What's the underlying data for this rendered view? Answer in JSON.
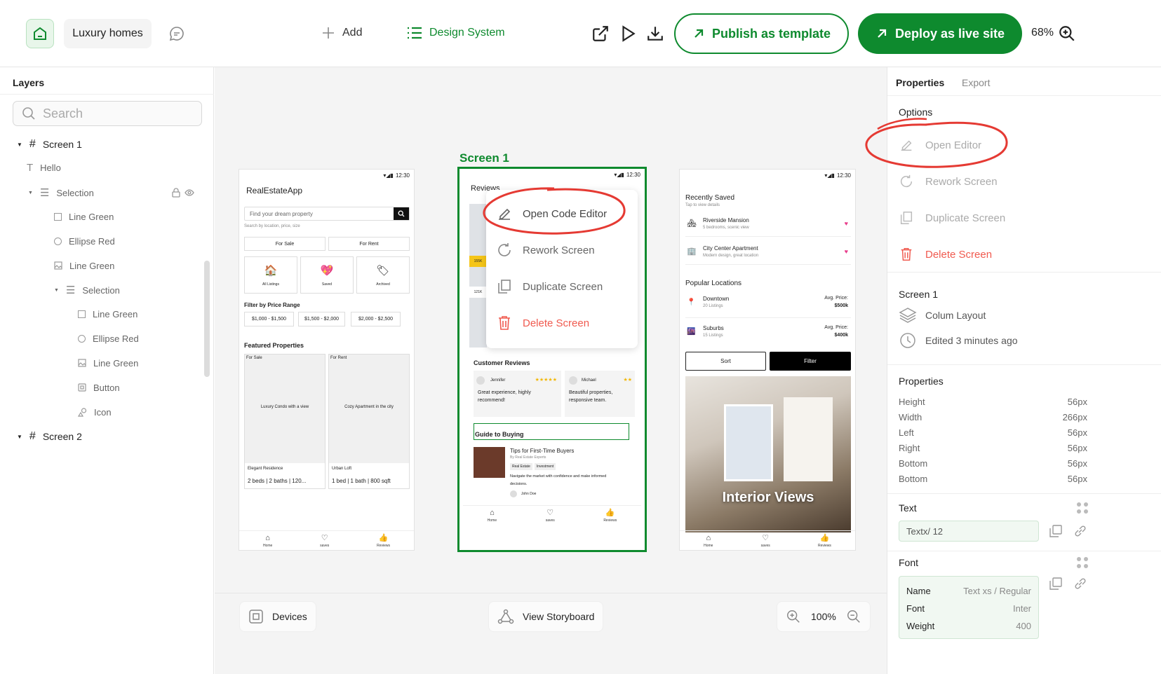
{
  "topbar": {
    "project_name": "Luxury homes",
    "add_label": "Add",
    "design_system_label": "Design System",
    "publish_label": "Publish as template",
    "deploy_label": "Deploy as live site",
    "zoom": "68%"
  },
  "layers": {
    "title": "Layers",
    "search_placeholder": "Search",
    "items": [
      {
        "label": "Screen 1"
      },
      {
        "label": "Hello"
      },
      {
        "label": "Selection"
      },
      {
        "label": "Line Green"
      },
      {
        "label": "Ellipse Red"
      },
      {
        "label": "Line Green"
      },
      {
        "label": "Selection"
      },
      {
        "label": "Line Green"
      },
      {
        "label": "Ellipse Red"
      },
      {
        "label": "Line Green"
      },
      {
        "label": "Button"
      },
      {
        "label": "Icon"
      },
      {
        "label": "Screen 2"
      }
    ]
  },
  "canvas": {
    "screen_label": "Screen 1",
    "status_time": "12:30",
    "phone1": {
      "app_title": "RealEstateApp",
      "search_placeholder": "Find your dream property",
      "search_hint": "Search by location, price, size",
      "for_sale": "For Sale",
      "for_rent": "For Rent",
      "cards": [
        "All Listings",
        "Saved",
        "Archived"
      ],
      "price_title": "Filter by Price Range",
      "prices": [
        "$1,000 - $1,500",
        "$1,500 - $2,000",
        "$2,000 - $2,500"
      ],
      "featured_title": "Featured Properties",
      "featured": [
        {
          "badge": "For Sale",
          "caption": "Luxury Condo with a view",
          "name": "Elegant Residence",
          "info": "2 beds | 2 baths | 120..."
        },
        {
          "badge": "For Rent",
          "caption": "Cozy Apartment in the city",
          "name": "Urban Loft",
          "info": "1 bed | 1 bath | 800 sqft"
        }
      ],
      "tabs": [
        "Home",
        "saves",
        "Reviews"
      ]
    },
    "phone2": {
      "title": "Reviews",
      "menu": [
        "Open Code Editor",
        "Rework Screen",
        "Duplicate Screen",
        "Delete Screen"
      ],
      "price_tag_1": "155K",
      "price_tag_2": "121K",
      "reviews_title": "Customer Reviews",
      "reviews": [
        {
          "name": "Jennifer",
          "stars": "★★★★★",
          "text": "Great experience, highly recommend!"
        },
        {
          "name": "Michael",
          "stars": "★★",
          "text": "Beautiful properties, responsive team."
        }
      ],
      "guide_title": "Guide to Buying",
      "article_title": "Tips for First-Time Buyers",
      "article_by": "By Real Estate Experts",
      "tags": [
        "Real Estate",
        "Investment"
      ],
      "article_text": "Navigate the market with confidence and make informed decisions.",
      "author": "John Doe",
      "tabs": [
        "Home",
        "saves",
        "Reviews"
      ]
    },
    "phone3": {
      "recent_title": "Recently Saved",
      "recent_sub": "Tap to view details",
      "recent": [
        {
          "name": "Riverside Mansion",
          "desc": "5 bedrooms, scenic view"
        },
        {
          "name": "City Center Apartment",
          "desc": "Modern design, great location"
        }
      ],
      "popular_title": "Popular Locations",
      "popular": [
        {
          "name": "Downtown",
          "count": "20 Listings",
          "price_label": "Avg. Price:",
          "price": "$500k"
        },
        {
          "name": "Suburbs",
          "count": "15 Listings",
          "price_label": "Avg. Price:",
          "price": "$400k"
        }
      ],
      "sort": "Sort",
      "filter": "Filter",
      "image_caption": "Interior Views",
      "tabs": [
        "Home",
        "saves",
        "Reviews"
      ]
    }
  },
  "bottombar": {
    "devices": "Devices",
    "storyboard": "View Storyboard",
    "zoom": "100%"
  },
  "right": {
    "tabs": [
      "Properties",
      "Export"
    ],
    "options_title": "Options",
    "options": [
      "Open Editor",
      "Rework Screen",
      "Duplicate Screen",
      "Delete Screen"
    ],
    "screen_title": "Screen 1",
    "layout": "Colum Layout",
    "edited": "Edited 3 minutes ago",
    "properties_title": "Properties",
    "properties": [
      {
        "name": "Height",
        "value": "56px"
      },
      {
        "name": "Width",
        "value": "266px"
      },
      {
        "name": "Left",
        "value": "56px"
      },
      {
        "name": "Right",
        "value": "56px"
      },
      {
        "name": "Bottom",
        "value": "56px"
      },
      {
        "name": "Bottom",
        "value": "56px"
      }
    ],
    "text_title": "Text",
    "text_value": "Textx/  12",
    "font_title": "Font",
    "font_rows": [
      {
        "name": "Name",
        "value": "Text xs / Regular"
      },
      {
        "name": "Font",
        "value": "Inter"
      },
      {
        "name": "Weight",
        "value": "400"
      }
    ]
  },
  "colors": {
    "accent": "#0e8a2e",
    "danger": "#f05a4f",
    "annotation": "#e53a33"
  }
}
